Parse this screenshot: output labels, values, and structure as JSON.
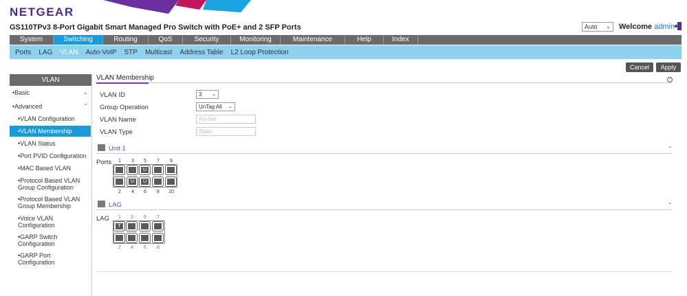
{
  "header": {
    "logo": "NETGEAR",
    "product_title": "GS110TPv3 8-Port Gigabit Smart Managed Pro Switch with PoE+ and 2 SFP Ports",
    "language": "Auto",
    "welcome_label": "Welcome",
    "username": "admin"
  },
  "main_nav": [
    {
      "label": "System"
    },
    {
      "label": "Switching"
    },
    {
      "label": "Routing"
    },
    {
      "label": "QoS"
    },
    {
      "label": "Security"
    },
    {
      "label": "Monitoring"
    },
    {
      "label": "Maintenance"
    },
    {
      "label": "Help"
    },
    {
      "label": "Index"
    }
  ],
  "sub_nav": [
    {
      "label": "Ports"
    },
    {
      "label": "LAG"
    },
    {
      "label": "VLAN"
    },
    {
      "label": "Auto-VoIP"
    },
    {
      "label": "STP"
    },
    {
      "label": "Multicast"
    },
    {
      "label": "Address Table"
    },
    {
      "label": "L2 Loop Protection"
    }
  ],
  "actions": {
    "cancel": "Cancel",
    "apply": "Apply"
  },
  "sidebar": {
    "title": "VLAN",
    "basic": "Basic",
    "advanced": "Advanced",
    "items": [
      {
        "label": "VLAN Configuration"
      },
      {
        "label": "VLAN Membership"
      },
      {
        "label": "VLAN Status"
      },
      {
        "label": "Port PVID Configuration"
      },
      {
        "label": "MAC Based VLAN"
      },
      {
        "label": "Protocol Based VLAN Group Configuration"
      },
      {
        "label": "Protocol Based VLAN Group Membership"
      },
      {
        "label": "Voice VLAN Configuration"
      },
      {
        "label": "GARP Switch Configuration"
      },
      {
        "label": "GARP Port Configuration"
      }
    ]
  },
  "content": {
    "section_title": "VLAN Membership",
    "help": "?",
    "form": {
      "vlan_id_label": "VLAN ID",
      "vlan_id_value": "3",
      "group_op_label": "Group Operation",
      "group_op_value": "UnTag All",
      "vlan_name_label": "VLAN Name",
      "vlan_name_value": "Art-Net",
      "vlan_type_label": "VLAN Type",
      "vlan_type_value": "Static"
    },
    "unit": {
      "title": "Unit 1",
      "ports_label": "Ports",
      "top_numbers": [
        "1",
        "3",
        "5",
        "7",
        "9"
      ],
      "bottom_numbers": [
        "2",
        "4",
        "6",
        "8",
        "10"
      ],
      "top_marks": [
        "",
        "",
        "U",
        "",
        ""
      ],
      "bottom_marks": [
        "",
        "U",
        "U",
        "",
        ""
      ]
    },
    "lag": {
      "title": "LAG",
      "label": "LAG",
      "top_numbers": [
        "1",
        "3",
        "5",
        "7"
      ],
      "bottom_numbers": [
        "2",
        "4",
        "6",
        "8"
      ],
      "top_marks": [
        "T",
        "",
        "",
        ""
      ],
      "bottom_marks": [
        "",
        "",
        "",
        ""
      ]
    }
  },
  "colors": {
    "accent_blue": "#1a9ad6",
    "sub_nav": "#8fd2f0",
    "purple": "#7b3ba3",
    "nav_gray": "#6b6b6b"
  }
}
